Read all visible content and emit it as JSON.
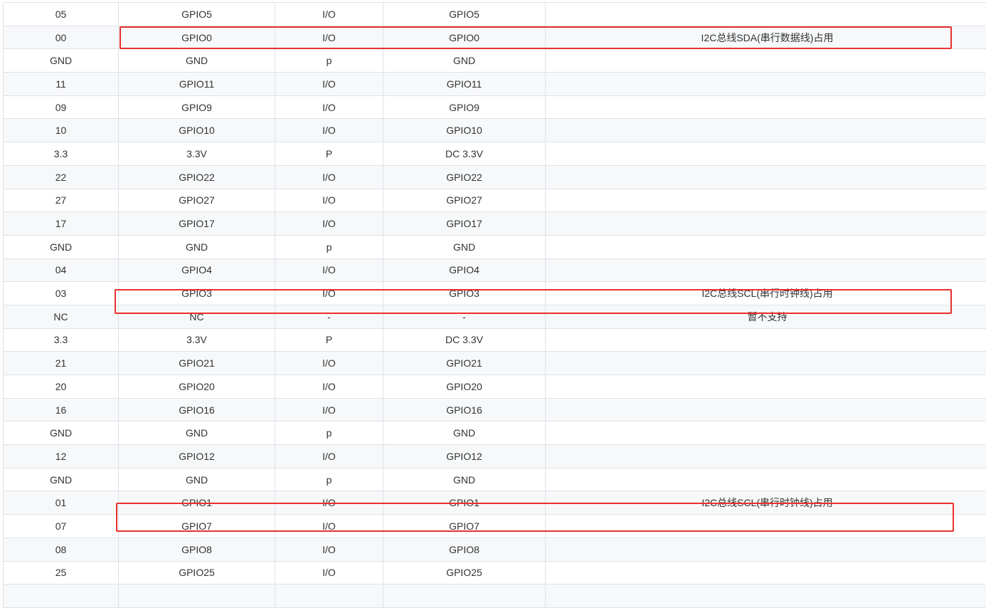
{
  "table": {
    "rows": [
      {
        "cells": [
          "05",
          "GPIO5",
          "I/O",
          "GPIO5",
          ""
        ]
      },
      {
        "cells": [
          "00",
          "GPIO0",
          "I/O",
          "GPIO0",
          "I2C总线SDA(串行数据线)占用"
        ],
        "highlighted": true
      },
      {
        "cells": [
          "GND",
          "GND",
          "p",
          "GND",
          ""
        ]
      },
      {
        "cells": [
          "11",
          "GPIO11",
          "I/O",
          "GPIO11",
          ""
        ]
      },
      {
        "cells": [
          "09",
          "GPIO9",
          "I/O",
          "GPIO9",
          ""
        ]
      },
      {
        "cells": [
          "10",
          "GPIO10",
          "I/O",
          "GPIO10",
          ""
        ]
      },
      {
        "cells": [
          "3.3",
          "3.3V",
          "P",
          "DC 3.3V",
          ""
        ]
      },
      {
        "cells": [
          "22",
          "GPIO22",
          "I/O",
          "GPIO22",
          ""
        ]
      },
      {
        "cells": [
          "27",
          "GPIO27",
          "I/O",
          "GPIO27",
          ""
        ]
      },
      {
        "cells": [
          "17",
          "GPIO17",
          "I/O",
          "GPIO17",
          ""
        ]
      },
      {
        "cells": [
          "GND",
          "GND",
          "p",
          "GND",
          ""
        ]
      },
      {
        "cells": [
          "04",
          "GPIO4",
          "I/O",
          "GPIO4",
          ""
        ]
      },
      {
        "cells": [
          "03",
          "GPIO3",
          "I/O",
          "GPIO3",
          "I2C总线SCL(串行时钟线)占用"
        ],
        "highlighted": true
      },
      {
        "cells": [
          "NC",
          "NC",
          "-",
          "-",
          "暂不支持"
        ]
      },
      {
        "cells": [
          "3.3",
          "3.3V",
          "P",
          "DC 3.3V",
          ""
        ]
      },
      {
        "cells": [
          "21",
          "GPIO21",
          "I/O",
          "GPIO21",
          ""
        ]
      },
      {
        "cells": [
          "20",
          "GPIO20",
          "I/O",
          "GPIO20",
          ""
        ]
      },
      {
        "cells": [
          "16",
          "GPIO16",
          "I/O",
          "GPIO16",
          ""
        ]
      },
      {
        "cells": [
          "GND",
          "GND",
          "p",
          "GND",
          ""
        ]
      },
      {
        "cells": [
          "12",
          "GPIO12",
          "I/O",
          "GPIO12",
          ""
        ]
      },
      {
        "cells": [
          "GND",
          "GND",
          "p",
          "GND",
          ""
        ]
      },
      {
        "cells": [
          "01",
          "GPIO1",
          "I/O",
          "GPIO1",
          "I2C总线SCL(串行时钟线)占用"
        ],
        "highlighted": true
      },
      {
        "cells": [
          "07",
          "GPIO7",
          "I/O",
          "GPIO7",
          ""
        ]
      },
      {
        "cells": [
          "08",
          "GPIO8",
          "I/O",
          "GPIO8",
          ""
        ]
      },
      {
        "cells": [
          "25",
          "GPIO25",
          "I/O",
          "GPIO25",
          ""
        ]
      },
      {
        "cells": [
          "",
          "",
          "",
          "",
          ""
        ]
      }
    ]
  },
  "colors": {
    "highlight": "#e8312d",
    "stripe": "#f6f8fa",
    "border": "#dfe2e5",
    "text": "#333333"
  }
}
